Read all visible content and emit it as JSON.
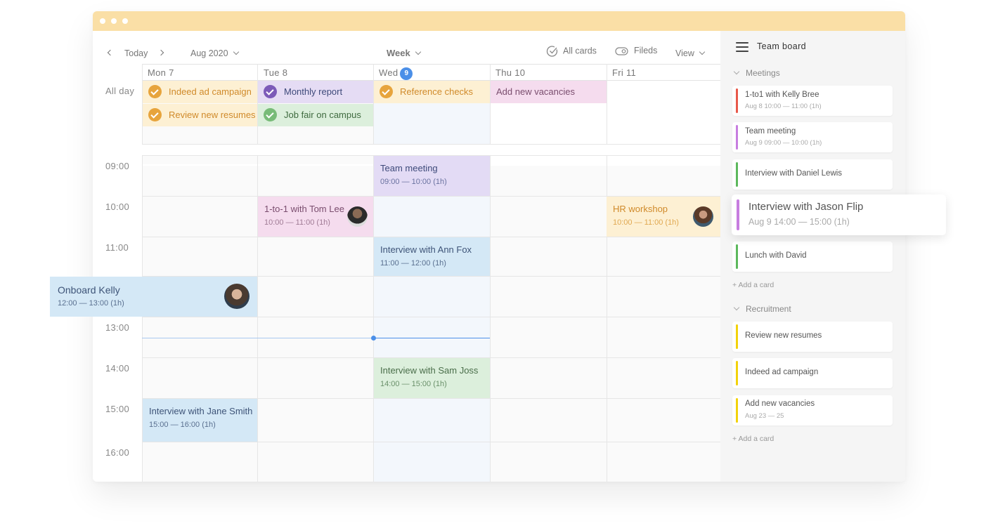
{
  "window": {
    "title_dots": 3,
    "titlebar_color": "#fadfa6"
  },
  "toolbar": {
    "prev_label": "‹",
    "today_label": "Today",
    "next_label": "›",
    "month_label": "Aug 2020",
    "view_mode_label": "Week",
    "all_cards_label": "All cards",
    "fields_label": "Fileds",
    "view_label": "View"
  },
  "calendar": {
    "allday_label": "All day",
    "days": [
      {
        "label": "Mon 7"
      },
      {
        "label": "Tue 8"
      },
      {
        "label": "Wed",
        "badge": "9",
        "today": true
      },
      {
        "label": "Thu 10"
      },
      {
        "label": "Fri 11"
      }
    ],
    "times": [
      "09:00",
      "10:00",
      "11:00",
      "12:00",
      "13:00",
      "14:00",
      "15:00",
      "16:00"
    ],
    "allday_events": [
      {
        "title": "Indeed ad campaign",
        "day": "Mon 7",
        "row": 1,
        "checked": true,
        "bg": "#fdf0d3",
        "check": "#e7a43c",
        "text": "#d08a2a"
      },
      {
        "title": "Review new resumes",
        "day": "Mon 7",
        "row": 2,
        "checked": true,
        "bg": "#fdf0d3",
        "check": "#e7a43c",
        "text": "#d08a2a"
      },
      {
        "title": "Monthly report",
        "day": "Tue 8",
        "row": 1,
        "checked": true,
        "bg": "#e5dcf4",
        "check": "#7c5bb8",
        "text": "#3e4a7a"
      },
      {
        "title": "Job fair on campus",
        "day": "Tue 8",
        "row": 2,
        "checked": true,
        "bg": "#dcefdc",
        "check": "#78bb78",
        "text": "#3f6a3f"
      },
      {
        "title": "Reference checks",
        "day": "Wed 9",
        "row": 1,
        "checked": true,
        "bg": "#fdf0d3",
        "check": "#e7a43c",
        "text": "#d08a2a"
      },
      {
        "title": "Add new vacancies",
        "day": "Thu 10",
        "row": 1,
        "checked": false,
        "bg": "#f5dcee",
        "text": "#7a4d6e"
      }
    ],
    "events": [
      {
        "title": "Team meeting",
        "time": "09:00 — 10:00 (1h)",
        "day": "Wed 9",
        "bg": "#e3dbf5",
        "text": "#3e4a7a"
      },
      {
        "title": "1-to-1 with Tom Lee",
        "time": "10:00 — 11:00 (1h)",
        "day": "Tue 8",
        "bg": "#f5dcee",
        "text": "#7a4d6e",
        "avatar": "man-sunglasses"
      },
      {
        "title": "HR workshop",
        "time": "10:00 — 11:00 (1h)",
        "day": "Fri 11",
        "bg": "#fdf0d3",
        "text": "#d08a2a",
        "avatar": "woman-brown-hair"
      },
      {
        "title": "Interview with Ann Fox",
        "time": "11:00 — 12:00 (1h)",
        "day": "Wed 9",
        "bg": "#d4e8f6",
        "text": "#3e5478"
      },
      {
        "title": "Onboard Kelly",
        "time": "12:00 — 13:00 (1h)",
        "day": "Mon 7",
        "bg": "#d4e8f6",
        "text": "#3e5478",
        "avatar": "woman-smiling",
        "dragging": true
      },
      {
        "title": "Interview with Sam Joss",
        "time": "14:00 — 15:00 (1h)",
        "day": "Wed 9",
        "bg": "#dcefdc",
        "text": "#4a6e4a"
      },
      {
        "title": "Interview with Jane Smith",
        "time": "15:00 — 16:00 (1h)",
        "day": "Mon 7",
        "bg": "#d4e8f6",
        "text": "#3e5478"
      }
    ],
    "now_indicator_time": "13:30",
    "today_column_color": "#f3f7fc"
  },
  "sidepanel": {
    "title": "Team board",
    "sections": [
      {
        "name": "Meetings",
        "cards": [
          {
            "title": "1-to1 with Kelly Bree",
            "subtitle": "Aug 8 10:00 — 11:00 (1h)",
            "color": "#e8584a"
          },
          {
            "title": "Team meeting",
            "subtitle": "Aug 9 09:00 — 10:00 (1h)",
            "color": "#c77de0"
          },
          {
            "title": "Interview with Daniel Lewis",
            "subtitle": "",
            "color": "#5cb85c"
          },
          {
            "title": "Interview with Jason Flip",
            "subtitle": "Aug 9 14:00 — 15:00 (1h)",
            "color": "#c77de0",
            "dragging": true
          },
          {
            "title": "Lunch with David",
            "subtitle": "",
            "color": "#5cb85c"
          }
        ],
        "add_label": "+ Add a card"
      },
      {
        "name": "Recruitment",
        "cards": [
          {
            "title": "Review new resumes",
            "subtitle": "",
            "color": "#f2d20a"
          },
          {
            "title": "Indeed ad campaign",
            "subtitle": "",
            "color": "#f2d20a"
          },
          {
            "title": "Add new vacancies",
            "subtitle": "Aug 23 — 25",
            "color": "#f2d20a"
          }
        ],
        "add_label": "+ Add a card"
      }
    ]
  }
}
